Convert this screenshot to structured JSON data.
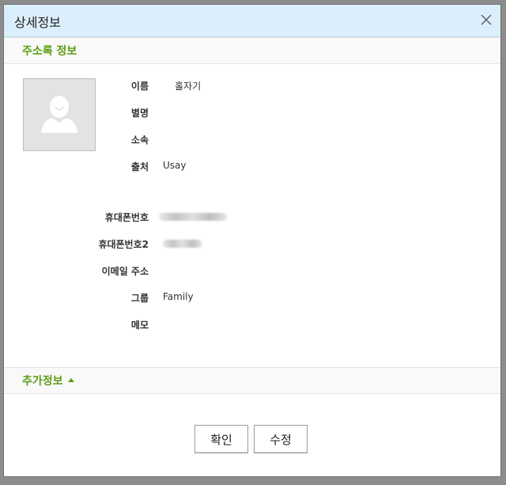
{
  "dialog": {
    "title": "상세정보",
    "close_icon": "close-icon"
  },
  "section_contact": {
    "label": "주소록 정보"
  },
  "contact": {
    "photo_icon": "person-placeholder-icon",
    "fields": [
      {
        "label": "이름",
        "value": "홀자기"
      },
      {
        "label": "별명",
        "value": ""
      },
      {
        "label": "소속",
        "value": ""
      },
      {
        "label": "출처",
        "value": "Usay"
      },
      {
        "label": "휴대폰번호",
        "value": ""
      },
      {
        "label": "휴대폰번호2",
        "value": ""
      },
      {
        "label": "이메일 주소",
        "value": ""
      },
      {
        "label": "그룹",
        "value": "Family"
      },
      {
        "label": "메모",
        "value": ""
      }
    ]
  },
  "section_extra": {
    "label": "추가정보",
    "toggle_icon": "caret-up-icon"
  },
  "buttons": {
    "confirm": "확인",
    "edit": "수정"
  },
  "colors": {
    "titlebar": "#dbeefb",
    "section_label": "#5a9e14"
  }
}
